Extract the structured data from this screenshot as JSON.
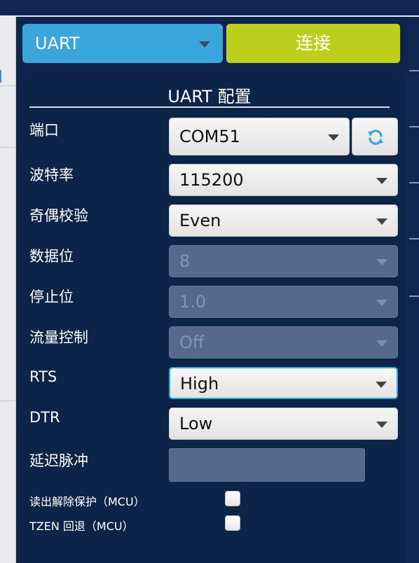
{
  "mode": {
    "selected": "UART"
  },
  "connect_label": "连接",
  "config": {
    "title": "UART 配置",
    "port": {
      "label": "端口",
      "value": "COM51"
    },
    "baud": {
      "label": "波特率",
      "value": "115200"
    },
    "parity": {
      "label": "奇偶校验",
      "value": "Even"
    },
    "databits": {
      "label": "数据位",
      "value": "8"
    },
    "stopbits": {
      "label": "停止位",
      "value": "1.0"
    },
    "flow": {
      "label": "流量控制",
      "value": "Off"
    },
    "rts": {
      "label": "RTS",
      "value": "High"
    },
    "dtr": {
      "label": "DTR",
      "value": "Low"
    },
    "delay": {
      "label": "延迟脉冲",
      "value": ""
    },
    "read_unprotect": {
      "label": "读出解除保护（MCU）",
      "checked": false
    },
    "tzen": {
      "label": "TZEN 回退（MCU）",
      "checked": false
    }
  },
  "colors": {
    "background": "#10254d",
    "mode_select": "#3aa6dc",
    "connect_button": "#bccf1c",
    "focus_border": "#2ea6dc",
    "disabled_field": "#556a8b"
  },
  "icons": {
    "refresh": "refresh-icon",
    "dropdown": "chevron-down-icon"
  }
}
